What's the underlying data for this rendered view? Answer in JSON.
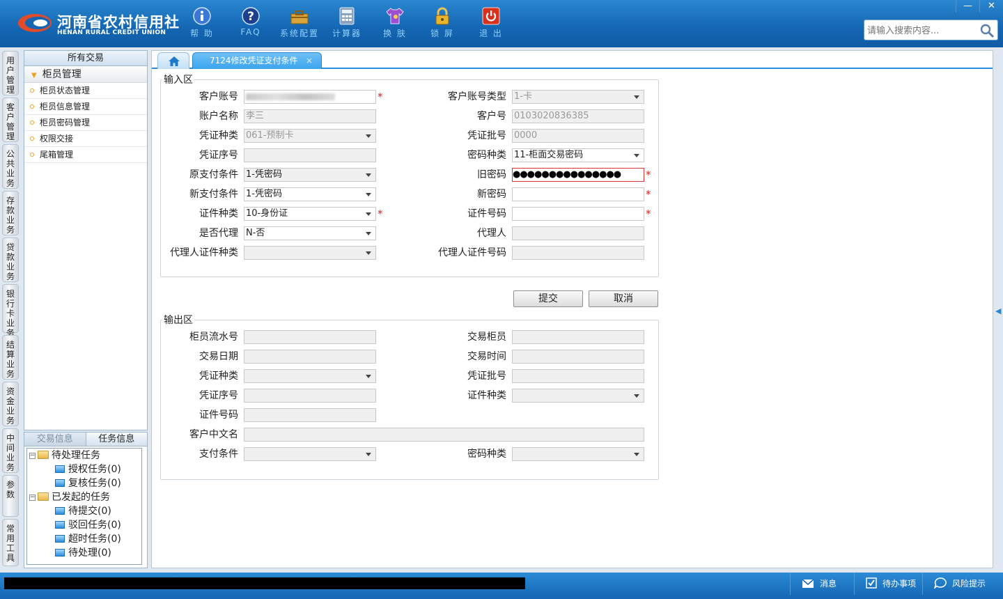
{
  "header": {
    "logo_cn": "河南省农村信用社",
    "logo_en": "HENAN RURAL CREDIT UNION",
    "tools": [
      {
        "label": "帮 助",
        "icon": "info-icon"
      },
      {
        "label": "FAQ",
        "icon": "question-icon"
      },
      {
        "label": "系统配置",
        "icon": "toolbox-icon"
      },
      {
        "label": "计算器",
        "icon": "calculator-icon"
      },
      {
        "label": "换 肤",
        "icon": "shirt-icon"
      },
      {
        "label": "锁 屏",
        "icon": "lock-icon"
      },
      {
        "label": "退 出",
        "icon": "power-icon"
      }
    ],
    "window_controls": {
      "minimize": "—",
      "close": "✕"
    },
    "search_placeholder": "请输入搜索内容..."
  },
  "vtabs": [
    "用户管理",
    "客户管理",
    "公共业务",
    "存款业务",
    "贷款业务",
    "银行卡业务",
    "结算业务",
    "资金业务",
    "中间业务",
    "参数",
    "常用工具"
  ],
  "nav": {
    "title": "所有交易",
    "group": "柜员管理",
    "items": [
      "柜员状态管理",
      "柜员信息管理",
      "柜员密码管理",
      "权限交接",
      "尾箱管理"
    ]
  },
  "task_panel": {
    "tabs": [
      "交易信息",
      "任务信息"
    ],
    "tree": {
      "pending": "待处理任务",
      "pending_children": [
        "授权任务(0)",
        "复核任务(0)"
      ],
      "initiated": "已发起的任务",
      "initiated_children": [
        "待提交(0)",
        "驳回任务(0)",
        "超时任务(0)",
        "待处理(0)"
      ]
    }
  },
  "main": {
    "active_tab": "7124修改凭证支付条件",
    "tab_close": "×",
    "input_section": {
      "title": "输入区",
      "fields": {
        "cust_account_label": "客户账号",
        "cust_account_type_label": "客户账号类型",
        "cust_account_type": "1-卡",
        "account_name_label": "账户名称",
        "account_name": "李三",
        "customer_no_label": "客户号",
        "customer_no": "0103020836385",
        "voucher_type_label": "凭证种类",
        "voucher_type": "061-预制卡",
        "voucher_batch_label": "凭证批号",
        "voucher_batch": "0000",
        "voucher_seq_label": "凭证序号",
        "password_type_label": "密码种类",
        "password_type": "11-柜面交易密码",
        "orig_pay_cond_label": "原支付条件",
        "orig_pay_cond": "1-凭密码",
        "old_password_label": "旧密码",
        "old_password_mask": "●●●●●●●●●●●●●●●",
        "new_pay_cond_label": "新支付条件",
        "new_pay_cond": "1-凭密码",
        "new_password_label": "新密码",
        "id_type_label": "证件种类",
        "id_type": "10-身份证",
        "id_no_label": "证件号码",
        "is_agent_label": "是否代理",
        "is_agent": "N-否",
        "agent_label": "代理人",
        "agent_id_type_label": "代理人证件种类",
        "agent_id_no_label": "代理人证件号码"
      }
    },
    "buttons": {
      "submit": "提交",
      "cancel": "取消"
    },
    "output_section": {
      "title": "输出区",
      "fields": {
        "teller_serial_label": "柜员流水号",
        "trade_teller_label": "交易柜员",
        "trade_date_label": "交易日期",
        "trade_time_label": "交易时间",
        "voucher_type_label": "凭证种类",
        "voucher_batch_label": "凭证批号",
        "voucher_seq_label": "凭证序号",
        "id_type_label": "证件种类",
        "id_no_label": "证件号码",
        "cust_cn_name_label": "客户中文名",
        "pay_cond_label": "支付条件",
        "password_type_label": "密码种类"
      }
    },
    "required_mark": "*"
  },
  "statusbar": {
    "message": "消息",
    "todo": "待办事项",
    "risk": "风险提示"
  },
  "colors": {
    "header_blue": "#1466b3",
    "tab_active": "#3aa4ee",
    "required_red": "#d22"
  }
}
